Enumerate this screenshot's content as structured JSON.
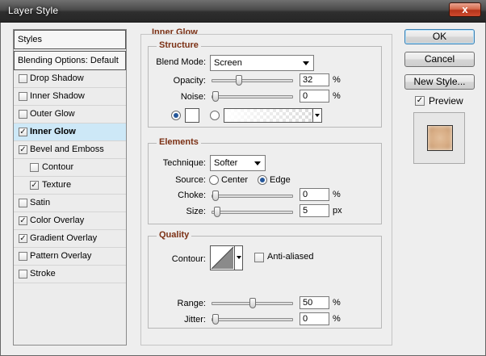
{
  "window": {
    "title": "Layer Style",
    "close_glyph": "x"
  },
  "styles_list": {
    "header": "Styles",
    "blending": "Blending Options: Default",
    "items": [
      {
        "label": "Drop Shadow",
        "checked": false
      },
      {
        "label": "Inner Shadow",
        "checked": false
      },
      {
        "label": "Outer Glow",
        "checked": false
      },
      {
        "label": "Inner Glow",
        "checked": true,
        "selected": true
      },
      {
        "label": "Bevel and Emboss",
        "checked": true
      },
      {
        "label": "Contour",
        "checked": false,
        "indent": true
      },
      {
        "label": "Texture",
        "checked": true,
        "indent": true
      },
      {
        "label": "Satin",
        "checked": false
      },
      {
        "label": "Color Overlay",
        "checked": true
      },
      {
        "label": "Gradient Overlay",
        "checked": true
      },
      {
        "label": "Pattern Overlay",
        "checked": false
      },
      {
        "label": "Stroke",
        "checked": false
      }
    ]
  },
  "panel": {
    "title": "Inner Glow",
    "structure": {
      "title": "Structure",
      "blend_mode_label": "Blend Mode:",
      "blend_mode_value": "Screen",
      "opacity_label": "Opacity:",
      "opacity_value": "32",
      "opacity_unit": "%",
      "opacity_level": 0.32,
      "noise_label": "Noise:",
      "noise_value": "0",
      "noise_unit": "%",
      "noise_level": 0.0,
      "color_swatch": "#ffffff"
    },
    "elements": {
      "title": "Elements",
      "technique_label": "Technique:",
      "technique_value": "Softer",
      "source_label": "Source:",
      "source_center": "Center",
      "source_edge": "Edge",
      "choke_label": "Choke:",
      "choke_value": "0",
      "choke_unit": "%",
      "choke_level": 0.0,
      "size_label": "Size:",
      "size_value": "5",
      "size_unit": "px",
      "size_level": 0.02
    },
    "quality": {
      "title": "Quality",
      "contour_label": "Contour:",
      "antialiased_label": "Anti-aliased",
      "range_label": "Range:",
      "range_value": "50",
      "range_unit": "%",
      "range_level": 0.5,
      "jitter_label": "Jitter:",
      "jitter_value": "0",
      "jitter_unit": "%",
      "jitter_level": 0.0
    }
  },
  "buttons": {
    "ok": "OK",
    "cancel": "Cancel",
    "new_style": "New Style...",
    "preview_label": "Preview",
    "preview_checked": true
  },
  "colors": {
    "accent_title": "#7b3014",
    "selection": "#cde8f7",
    "preview_swatch": "#d8ad85"
  }
}
